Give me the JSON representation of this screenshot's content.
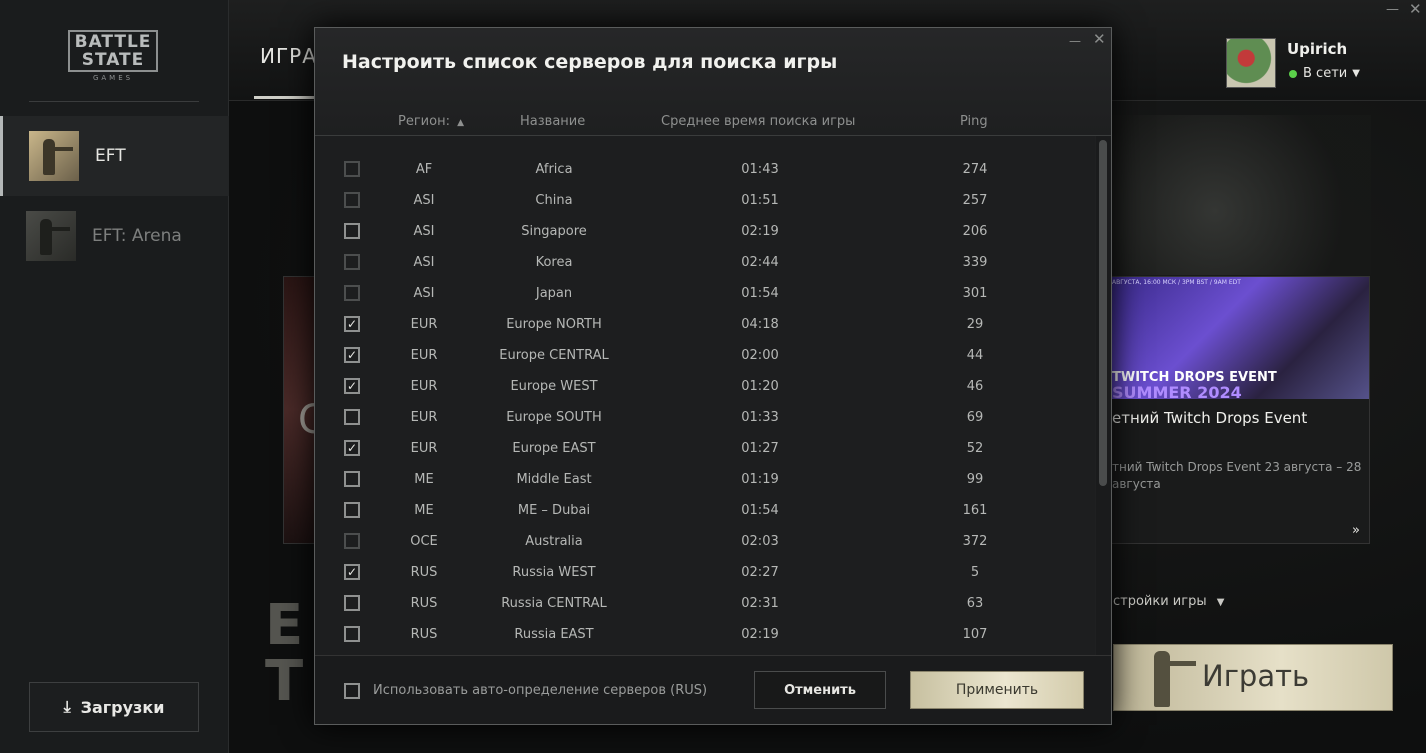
{
  "logo": {
    "line1": "BATTLE STATE",
    "line2": "GAMES"
  },
  "sidebar": {
    "games": [
      {
        "label": "EFT",
        "active": true
      },
      {
        "label": "EFT: Arena",
        "active": false
      }
    ],
    "downloads_label": "Загрузки",
    "downloads_icon": "download-icon"
  },
  "header": {
    "tab_games": "ИГРА",
    "user": {
      "name": "Upirich",
      "status": "В сети",
      "status_color": "#5bd04a"
    }
  },
  "news": {
    "img_tiny": "АВГУСТА, 16:00 МСК / 3PM BST / 9AM EDT",
    "img_line1": "TWITCH DROPS EVENT",
    "img_line2": "SUMMER 2024",
    "title": "етний Twitch Drops Event",
    "text": "тний Twitch Drops Event 23 августа – 28 августа",
    "more": "»"
  },
  "game_settings_label": "стройки игры",
  "play_label": "Играть",
  "modal": {
    "title": "Настроить список серверов для поиска игры",
    "columns": {
      "region": "Регион:",
      "name": "Название",
      "avg_time": "Среднее время поиска игры",
      "ping": "Ping"
    },
    "rows": [
      {
        "region": "AF",
        "name": "Africa",
        "time": "01:43",
        "ping": "274",
        "mark": "",
        "disabled": true
      },
      {
        "region": "ASI",
        "name": "China",
        "time": "01:51",
        "ping": "257",
        "mark": "",
        "disabled": true
      },
      {
        "region": "ASI",
        "name": "Singapore",
        "time": "02:19",
        "ping": "206",
        "mark": "",
        "disabled": false
      },
      {
        "region": "ASI",
        "name": "Korea",
        "time": "02:44",
        "ping": "339",
        "mark": "",
        "disabled": true
      },
      {
        "region": "ASI",
        "name": "Japan",
        "time": "01:54",
        "ping": "301",
        "mark": "",
        "disabled": true
      },
      {
        "region": "EUR",
        "name": "Europe NORTH",
        "time": "04:18",
        "ping": "29",
        "mark": "✓",
        "disabled": false
      },
      {
        "region": "EUR",
        "name": "Europe CENTRAL",
        "time": "02:00",
        "ping": "44",
        "mark": "✓",
        "disabled": false
      },
      {
        "region": "EUR",
        "name": "Europe WEST",
        "time": "01:20",
        "ping": "46",
        "mark": "✓",
        "disabled": false
      },
      {
        "region": "EUR",
        "name": "Europe SOUTH",
        "time": "01:33",
        "ping": "69",
        "mark": "",
        "disabled": false
      },
      {
        "region": "EUR",
        "name": "Europe EAST",
        "time": "01:27",
        "ping": "52",
        "mark": "✓",
        "disabled": false
      },
      {
        "region": "ME",
        "name": "Middle East",
        "time": "01:19",
        "ping": "99",
        "mark": "",
        "disabled": false
      },
      {
        "region": "ME",
        "name": "ME – Dubai",
        "time": "01:54",
        "ping": "161",
        "mark": "",
        "disabled": false
      },
      {
        "region": "OCE",
        "name": "Australia",
        "time": "02:03",
        "ping": "372",
        "mark": "",
        "disabled": true
      },
      {
        "region": "RUS",
        "name": "Russia WEST",
        "time": "02:27",
        "ping": "5",
        "mark": "✓",
        "disabled": false
      },
      {
        "region": "RUS",
        "name": "Russia CENTRAL",
        "time": "02:31",
        "ping": "63",
        "mark": "",
        "disabled": false
      },
      {
        "region": "RUS",
        "name": "Russia EAST",
        "time": "02:19",
        "ping": "107",
        "mark": "",
        "disabled": false
      }
    ],
    "auto_detect_label": "Использовать авто-определение серверов (RUS)",
    "cancel_label": "Отменить",
    "apply_label": "Применить"
  }
}
